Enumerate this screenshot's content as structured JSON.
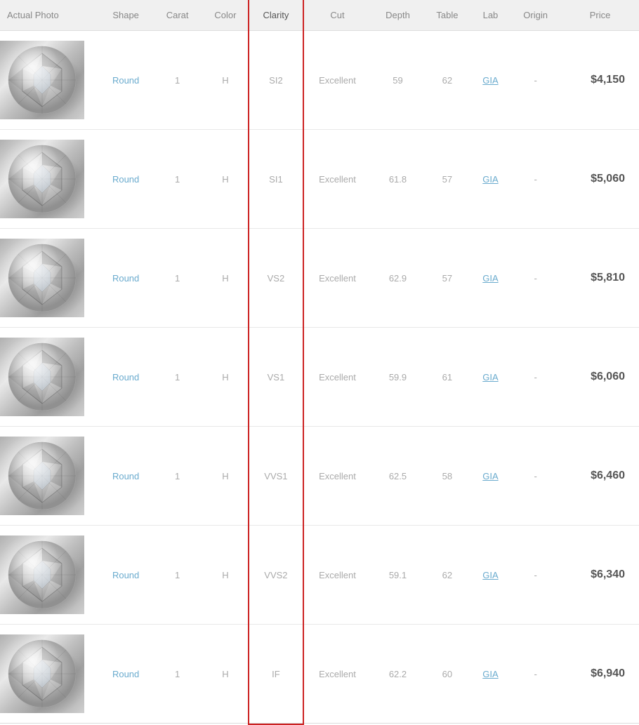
{
  "table": {
    "headers": {
      "actual_photo": "Actual Photo",
      "shape": "Shape",
      "carat": "Carat",
      "color": "Color",
      "clarity": "Clarity",
      "cut": "Cut",
      "depth": "Depth",
      "table": "Table",
      "lab": "Lab",
      "origin": "Origin",
      "price": "Price"
    },
    "rows": [
      {
        "shape": "Round",
        "carat": "1",
        "color": "H",
        "clarity": "SI2",
        "cut": "Excellent",
        "depth": "59",
        "table": "62",
        "lab": "GIA",
        "origin": "-",
        "price": "$4,150"
      },
      {
        "shape": "Round",
        "carat": "1",
        "color": "H",
        "clarity": "SI1",
        "cut": "Excellent",
        "depth": "61.8",
        "table": "57",
        "lab": "GIA",
        "origin": "-",
        "price": "$5,060"
      },
      {
        "shape": "Round",
        "carat": "1",
        "color": "H",
        "clarity": "VS2",
        "cut": "Excellent",
        "depth": "62.9",
        "table": "57",
        "lab": "GIA",
        "origin": "-",
        "price": "$5,810"
      },
      {
        "shape": "Round",
        "carat": "1",
        "color": "H",
        "clarity": "VS1",
        "cut": "Excellent",
        "depth": "59.9",
        "table": "61",
        "lab": "GIA",
        "origin": "-",
        "price": "$6,060"
      },
      {
        "shape": "Round",
        "carat": "1",
        "color": "H",
        "clarity": "VVS1",
        "cut": "Excellent",
        "depth": "62.5",
        "table": "58",
        "lab": "GIA",
        "origin": "-",
        "price": "$6,460"
      },
      {
        "shape": "Round",
        "carat": "1",
        "color": "H",
        "clarity": "VVS2",
        "cut": "Excellent",
        "depth": "59.1",
        "table": "62",
        "lab": "GIA",
        "origin": "-",
        "price": "$6,340"
      },
      {
        "shape": "Round",
        "carat": "1",
        "color": "H",
        "clarity": "IF",
        "cut": "Excellent",
        "depth": "62.2",
        "table": "60",
        "lab": "GIA",
        "origin": "-",
        "price": "$6,940"
      }
    ]
  }
}
